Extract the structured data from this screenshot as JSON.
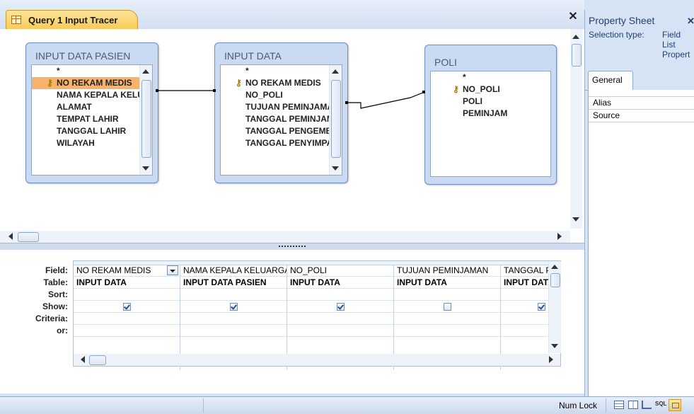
{
  "document_tab": {
    "title": "Query 1 Input Tracer"
  },
  "tables": [
    {
      "title": "INPUT DATA PASIEN",
      "fields": [
        "*",
        "NO REKAM MEDIS",
        "NAMA KEPALA KELUARGA",
        "ALAMAT",
        "TEMPAT LAHIR",
        "TANGGAL LAHIR",
        "WILAYAH"
      ],
      "key_index": 1,
      "selected_index": 1
    },
    {
      "title": "INPUT DATA",
      "fields": [
        "*",
        "NO REKAM MEDIS",
        "NO_POLI",
        "TUJUAN PEMINJAMAN",
        "TANGGAL PEMINJAMAN",
        "TANGGAL PENGEMBALIAN",
        "TANGGAL PENYIMPANAN"
      ],
      "key_index": 1
    },
    {
      "title": "POLI",
      "fields": [
        "*",
        "NO_POLI",
        "POLI",
        "PEMINJAM"
      ],
      "key_index": 1
    }
  ],
  "grid": {
    "row_labels": [
      "Field:",
      "Table:",
      "Sort:",
      "Show:",
      "Criteria:",
      "or:"
    ],
    "columns": [
      {
        "field": "NO REKAM MEDIS",
        "table": "INPUT DATA",
        "show": true
      },
      {
        "field": "NAMA KEPALA KELUARGA",
        "table": "INPUT DATA PASIEN",
        "show": true
      },
      {
        "field": "NO_POLI",
        "table": "INPUT DATA",
        "show": true
      },
      {
        "field": "TUJUAN PEMINJAMAN",
        "table": "INPUT DATA",
        "show": false
      },
      {
        "field": "TANGGAL PE",
        "table": "INPUT DATA",
        "show": true
      }
    ]
  },
  "property_sheet": {
    "title": "Property Sheet",
    "selection_label": "Selection type:",
    "selection_value_lines": [
      "Field",
      "List",
      "Propert"
    ],
    "tab": "General",
    "properties": [
      "Alias",
      "Source"
    ]
  },
  "status": {
    "num_lock": "Num Lock",
    "view_sql": "SQL"
  }
}
